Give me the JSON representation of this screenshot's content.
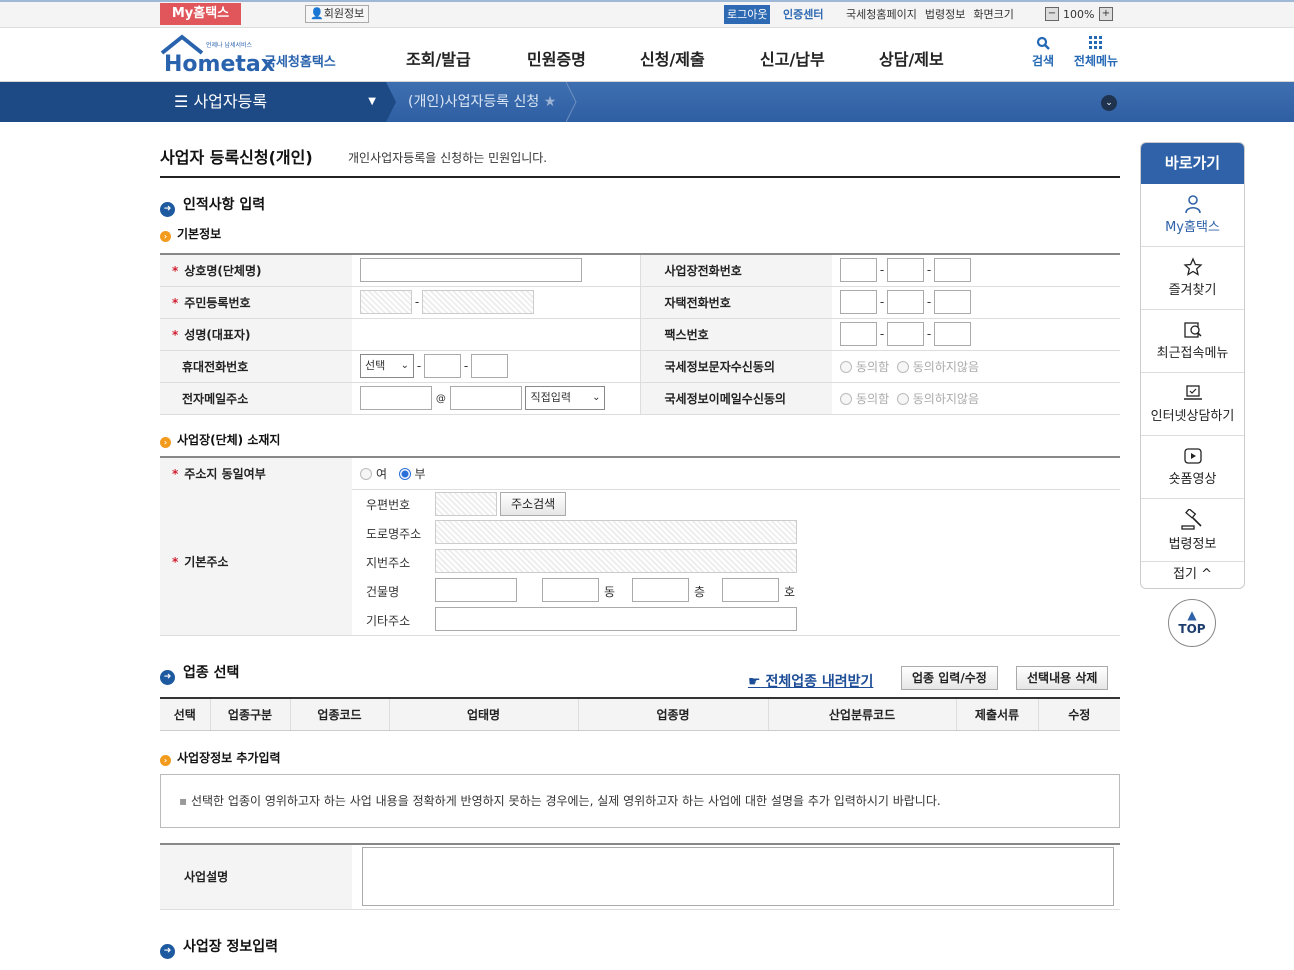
{
  "util": {
    "my_hometax": "My홈택스",
    "member_info": "회원정보",
    "logout": "로그아웃",
    "cert_center": "인증센터",
    "links": [
      "국세청홈페이지",
      "법령정보",
      "화면크기"
    ],
    "zoom_minus": "−",
    "zoom_value": "100%",
    "zoom_plus": "+"
  },
  "logo": {
    "small": "언제나 납세서비스",
    "main": "Hometax",
    "kor": "국세청홈택스"
  },
  "gnb": [
    "조회/발급",
    "민원증명",
    "신청/제출",
    "신고/납부",
    "상담/제보"
  ],
  "header_icons": {
    "search": "검색",
    "all_menu": "전체메뉴"
  },
  "bar": {
    "menu": "사업자등록",
    "crumb": "(개인)사업자등록 신청"
  },
  "page": {
    "title": "사업자 등록신청(개인)",
    "subtitle": "개인사업자등록을 신청하는 민원입니다."
  },
  "section1": {
    "title": "인적사항 입력",
    "sub": "기본정보",
    "fields": {
      "company": "상호명(단체명)",
      "rrn": "주민등록번호",
      "name": "성명(대표자)",
      "mobile": "휴대전화번호",
      "email": "전자메일주소",
      "biz_phone": "사업장전화번호",
      "home_phone": "자택전화번호",
      "fax": "팩스번호",
      "sms_agree": "국세정보문자수신동의",
      "email_agree": "국세정보이메일수신동의"
    },
    "mobile_select": "선택",
    "email_select": "직접입력",
    "at": "@",
    "agree": "동의함",
    "disagree": "동의하지않음"
  },
  "section_addr": {
    "sub": "사업장(단체) 소재지",
    "same_label": "주소지 동일여부",
    "yes": "여",
    "no": "부",
    "base_addr": "기본주소",
    "zip": "우편번호",
    "search_btn": "주소검색",
    "road": "도로명주소",
    "jibun": "지번주소",
    "building": "건물명",
    "dong": "동",
    "floor": "층",
    "ho": "호",
    "etc": "기타주소"
  },
  "section2": {
    "title": "업종 선택",
    "download": "전체업종 내려받기",
    "edit_btn": "업종 입력/수정",
    "delete_btn": "선택내용 삭제",
    "columns": [
      "선택",
      "업종구분",
      "업종코드",
      "업태명",
      "업종명",
      "산업분류코드",
      "제출서류",
      "수정"
    ]
  },
  "section_extra": {
    "sub": "사업장정보 추가입력",
    "notice": "선택한 업종이 영위하고자 하는 사업 내용을 정확하게 반영하지 못하는 경우에는, 실제 영위하고자 하는 사업에 대한 설명을 추가 입력하시기 바랍니다.",
    "desc_label": "사업설명"
  },
  "section3": {
    "title": "사업장 정보입력"
  },
  "quick": {
    "head": "바로가기",
    "items": [
      "My홈택스",
      "즐겨찾기",
      "최근접속메뉴",
      "인터넷상담하기",
      "숏폼영상",
      "법령정보"
    ],
    "fold": "접기 ^",
    "top": "TOP"
  },
  "colors": {
    "primary": "#2f62a8",
    "nav_dark": "#1d4a84",
    "required": "#d02030",
    "my_hometax": "#e0565a"
  }
}
